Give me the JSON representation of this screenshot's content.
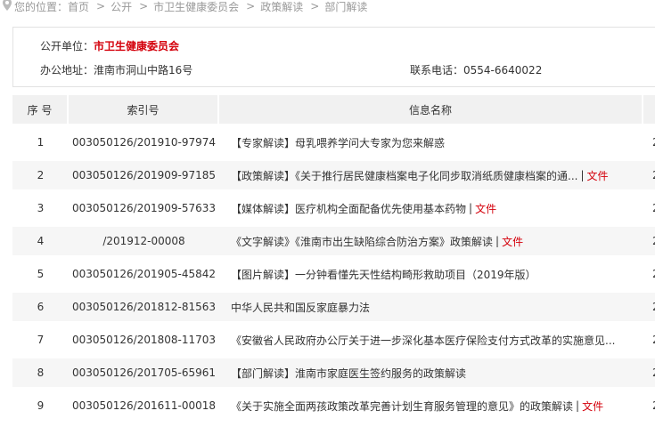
{
  "breadcrumb": {
    "items": [
      "您的位置：首页",
      "公开",
      "市卫生健康委员会",
      "政策解读",
      "部门解读"
    ]
  },
  "info": {
    "unit_label": "公开单位：",
    "unit_value": "市卫生健康委员会",
    "address_label": "办公地址：",
    "address_value": "淮南市洞山中路16号",
    "phone_label": "联系电话：",
    "phone_value": "0554-6640022"
  },
  "table": {
    "headers": {
      "no": "序 号",
      "index": "索引号",
      "name": "信息名称"
    },
    "rows": [
      {
        "no": "1",
        "index": "003050126/201910-97974",
        "name": "【专家解读】母乳喂养学问大专家为您来解惑",
        "file": "",
        "tail": "2"
      },
      {
        "no": "2",
        "index": "003050126/201909-97185",
        "name": "【政策解读】《关于推行居民健康档案电子化同步取消纸质健康档案的通...",
        "file": "文件",
        "tail": "2"
      },
      {
        "no": "3",
        "index": "003050126/201909-57633",
        "name": "【媒体解读】医疗机构全面配备优先使用基本药物",
        "file": "文件",
        "tail": "2"
      },
      {
        "no": "4",
        "index": "/201912-00008",
        "name": "《文字解读》《淮南市出生缺陷综合防治方案》政策解读",
        "file": "文件",
        "tail": "2"
      },
      {
        "no": "5",
        "index": "003050126/201905-45842",
        "name": "【图片解读】一分钟看懂先天性结构畸形救助项目（2019年版）",
        "file": "",
        "tail": "2"
      },
      {
        "no": "6",
        "index": "003050126/201812-81563",
        "name": "中华人民共和国反家庭暴力法",
        "file": "",
        "tail": "2"
      },
      {
        "no": "7",
        "index": "003050126/201808-11703",
        "name": "《安徽省人民政府办公厅关于进一步深化基本医疗保险支付方式改革的实施意见...",
        "file": "",
        "tail": "2"
      },
      {
        "no": "8",
        "index": "003050126/201705-65961",
        "name": "【部门解读】淮南市家庭医生签约服务的政策解读",
        "file": "",
        "tail": "2"
      },
      {
        "no": "9",
        "index": "003050126/201611-00018",
        "name": "《关于实施全面两孩政策改革完善计划生育服务管理的意见》的政策解读",
        "file": "文件",
        "tail": "2"
      }
    ]
  }
}
